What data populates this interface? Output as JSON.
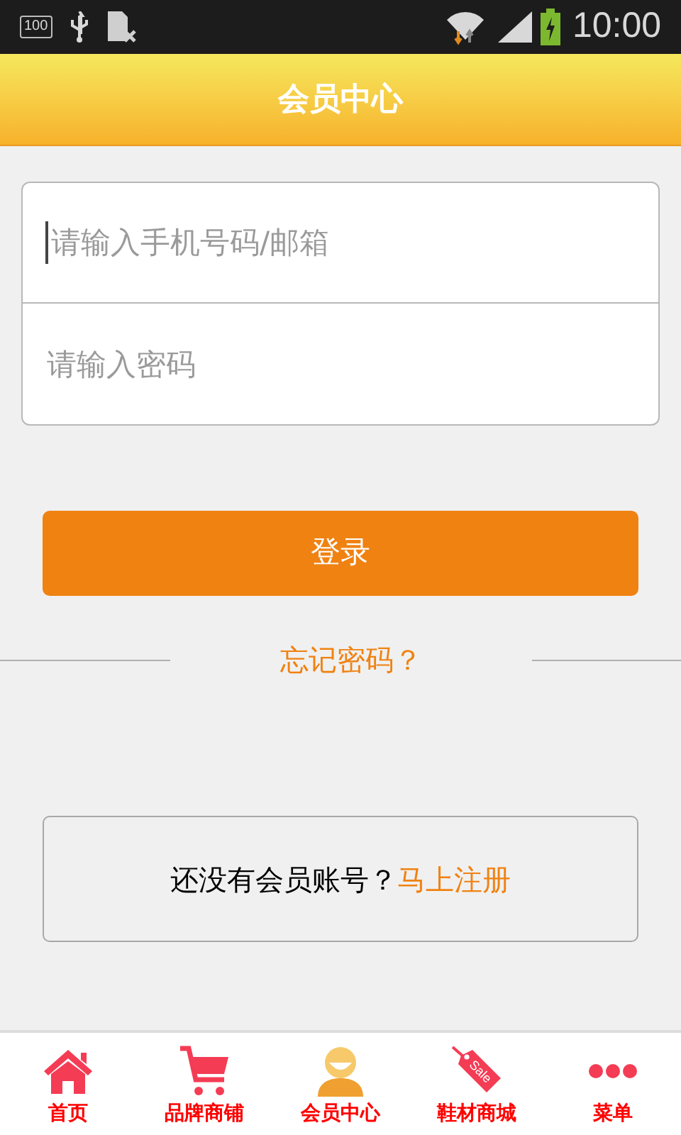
{
  "status_bar": {
    "storage_label": "100",
    "time": "10:00"
  },
  "header": {
    "title": "会员中心"
  },
  "login_form": {
    "fields": [
      {
        "placeholder": "请输入手机号码/邮箱",
        "focused": true
      },
      {
        "placeholder": "请输入密码",
        "focused": false
      }
    ],
    "submit": "登录",
    "forgot": "忘记密码？"
  },
  "register": {
    "text": "还没有会员账号？",
    "link": "马上注册"
  },
  "bottom_nav": [
    {
      "kind": "home",
      "label": "首页"
    },
    {
      "kind": "cart",
      "label": "品牌商铺"
    },
    {
      "kind": "member",
      "label": "会员中心"
    },
    {
      "kind": "tag",
      "label": "鞋材商城",
      "icon_text": "Sale"
    },
    {
      "kind": "more",
      "label": "菜单"
    }
  ]
}
